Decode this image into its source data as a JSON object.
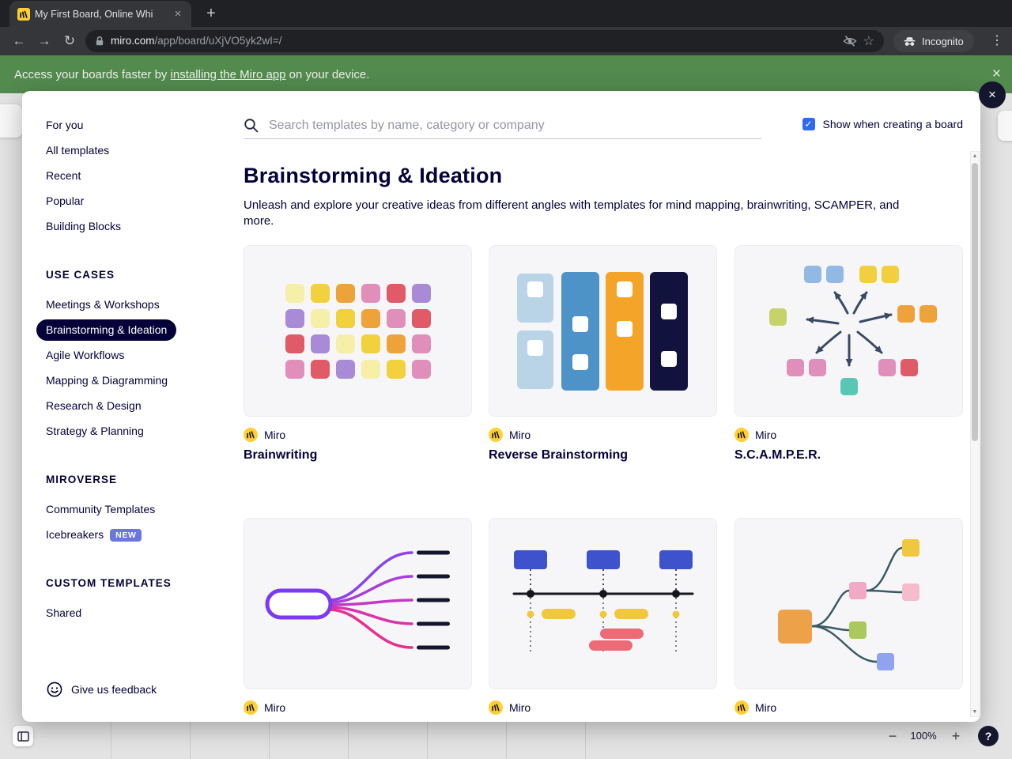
{
  "browser": {
    "tab": {
      "title": "My First Board, Online Whi",
      "close_glyph": "×",
      "new_tab_glyph": "+"
    },
    "nav": {
      "back_glyph": "←",
      "forward_glyph": "→",
      "reload_glyph": "↻",
      "url_host": "miro.com",
      "url_path": "/app/board/uXjVO5yk2wI=/",
      "star_glyph": "☆",
      "incognito_label": "Incognito",
      "menu_glyph": "⋮"
    }
  },
  "banner": {
    "prefix": "Access your boards faster by ",
    "link_text": "installing the Miro app",
    "suffix": " on your device.",
    "close_glyph": "×"
  },
  "modal": {
    "close_glyph": "×",
    "search_placeholder": "Search templates by name, category or company",
    "show_checkbox_label": "Show when creating a board",
    "check_glyph": "✓",
    "sidebar": {
      "top_items": [
        "For you",
        "All templates",
        "Recent",
        "Popular",
        "Building Blocks"
      ],
      "use_cases_header": "USE CASES",
      "use_cases": [
        "Meetings & Workshops",
        "Brainstorming & Ideation",
        "Agile Workflows",
        "Mapping & Diagramming",
        "Research & Design",
        "Strategy & Planning"
      ],
      "selected_index": 1,
      "miroverse_header": "MIROVERSE",
      "miroverse_items": [
        "Community Templates",
        "Icebreakers"
      ],
      "new_badge": "NEW",
      "custom_header": "CUSTOM TEMPLATES",
      "custom_items": [
        "Shared"
      ],
      "feedback_label": "Give us feedback"
    },
    "content": {
      "title": "Brainstorming & Ideation",
      "description": "Unleash and explore your creative ideas from different angles with templates for mind mapping, brainwriting, SCAMPER, and more.",
      "cards": [
        {
          "provider": "Miro",
          "title": "Brainwriting"
        },
        {
          "provider": "Miro",
          "title": "Reverse Brainstorming"
        },
        {
          "provider": "Miro",
          "title": "S.C.A.M.P.E.R."
        },
        {
          "provider": "Miro"
        },
        {
          "provider": "Miro"
        },
        {
          "provider": "Miro"
        }
      ]
    },
    "scrollbar": {
      "up_glyph": "▲",
      "down_glyph": "▼"
    }
  },
  "board": {
    "zoom_out_glyph": "−",
    "zoom_level": "100%",
    "zoom_in_glyph": "+",
    "help_glyph": "?"
  },
  "colors": {
    "banner_green": "#538a4e",
    "navy": "#050038",
    "accent_blue": "#2e6bf0",
    "new_badge_blue": "#6b77e0",
    "miro_yellow": "#ffd02f"
  }
}
